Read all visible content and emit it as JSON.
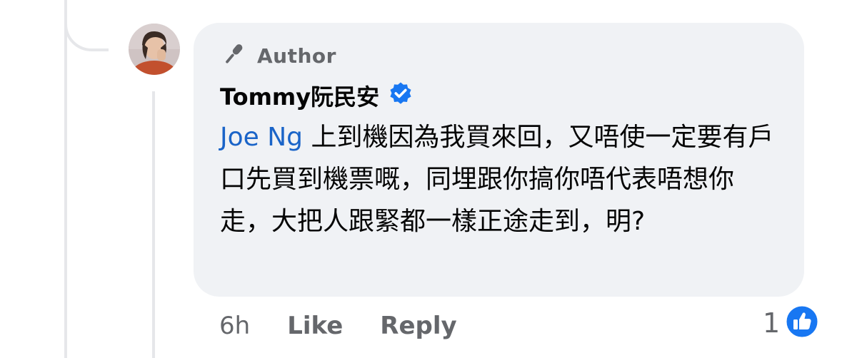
{
  "comment": {
    "author_badge": "Author",
    "author_name": "Tommy阮民安",
    "verified": true,
    "mention": "Joe Ng",
    "text": " 上到機因為我買來回，又唔使一定要有戶口先買到機票嘅，同埋跟你搞你唔代表唔想你走，大把人跟緊都一樣正途走到，明?",
    "timestamp": "6h",
    "like_label": "Like",
    "reply_label": "Reply",
    "reaction_count": "1"
  },
  "colors": {
    "bubble_bg": "#f0f2f5",
    "mention": "#1a64c8",
    "verified_badge": "#1877f2",
    "secondary_text": "#65676b"
  },
  "icons": {
    "author_badge": "microphone-icon",
    "verified": "verified-badge-icon",
    "reaction": "thumbs-up-icon"
  }
}
